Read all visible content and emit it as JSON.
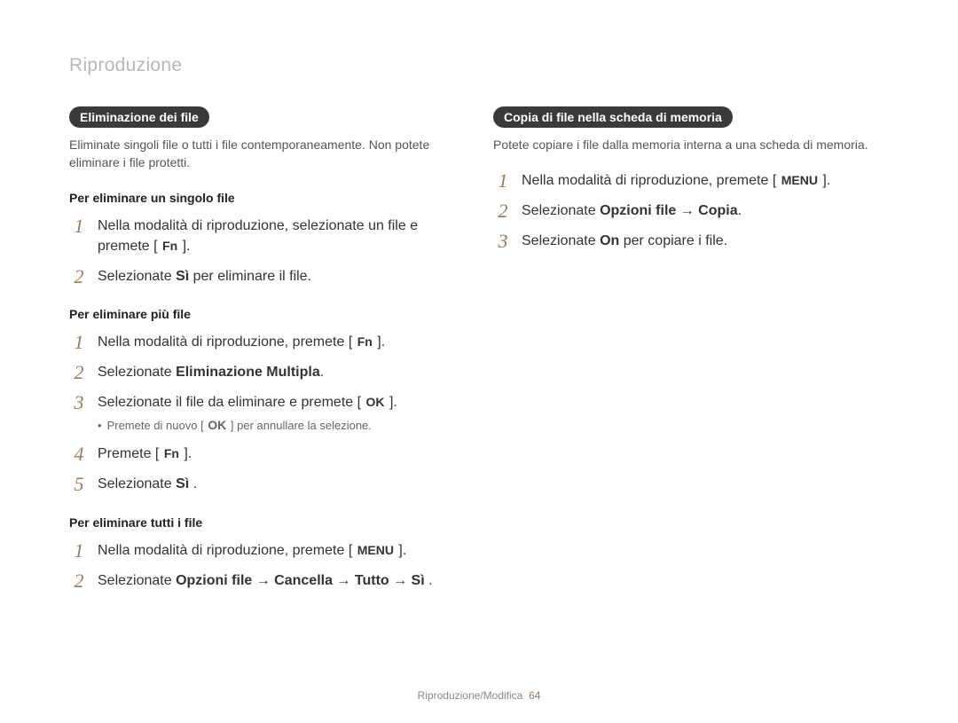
{
  "page_title": "Riproduzione",
  "footer": {
    "section": "Riproduzione/Modifica",
    "page": "64"
  },
  "keys": {
    "fn": "Fn",
    "ok": "OK",
    "menu": "MENU"
  },
  "left": {
    "pill": "Eliminazione dei file",
    "intro": "Eliminate singoli file o tutti i file contemporaneamente. Non potete eliminare i file protetti.",
    "section1": {
      "heading": "Per eliminare un singolo file",
      "step1_a": "Nella modalità di riproduzione, selezionate un file e premete [ ",
      "step1_b": " ].",
      "step2_a": "Selezionate ",
      "step2_si": "Sì",
      "step2_b": " per eliminare il file."
    },
    "section2": {
      "heading": "Per eliminare più file",
      "step1_a": "Nella modalità di riproduzione, premete [ ",
      "step1_b": " ].",
      "step2_a": "Selezionate ",
      "step2_bold": "Eliminazione Multipla",
      "step2_b": ".",
      "step3_a": "Selezionate il file da eliminare e premete [ ",
      "step3_b": " ].",
      "step3_note_a": "Premete di nuovo [ ",
      "step3_note_b": " ] per annullare la selezione.",
      "step4_a": "Premete [ ",
      "step4_b": " ].",
      "step5_a": "Selezionate ",
      "step5_bold": "Sì",
      "step5_b": " ."
    },
    "section3": {
      "heading": "Per eliminare tutti i file",
      "step1_a": "Nella modalità di riproduzione, premete [ ",
      "step1_b": " ].",
      "step2_a": "Selezionate ",
      "step2_bold": "Opzioni file → Cancella → Tutto → Sì",
      "step2_b": " ."
    }
  },
  "right": {
    "pill": "Copia di file nella scheda di memoria",
    "intro": "Potete copiare i file dalla memoria interna a una scheda di memoria.",
    "step1_a": "Nella modalità di riproduzione, premete [ ",
    "step1_b": " ].",
    "step2_a": "Selezionate ",
    "step2_bold": "Opzioni file → Copia",
    "step2_b": ".",
    "step3_a": "Selezionate ",
    "step3_bold": "On",
    "step3_b": " per copiare i file."
  }
}
